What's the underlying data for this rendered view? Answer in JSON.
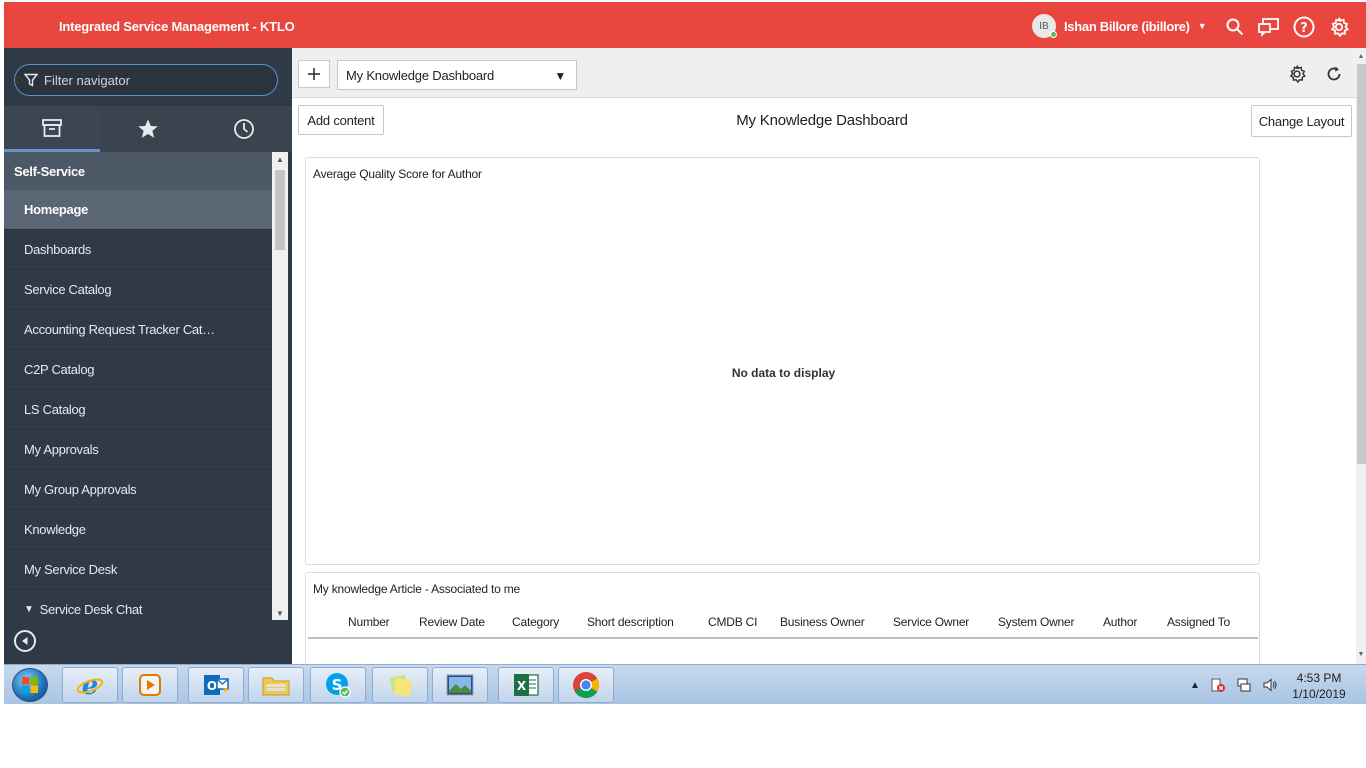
{
  "header": {
    "title": "Integrated Service Management - KTLO",
    "user_initials": "IB",
    "user_name": "Ishan Billore (ibillore)"
  },
  "sidebar": {
    "filter_placeholder": "Filter navigator",
    "section": "Self-Service",
    "items": [
      {
        "label": "Homepage"
      },
      {
        "label": "Dashboards"
      },
      {
        "label": "Service Catalog"
      },
      {
        "label": "Accounting Request Tracker Cat…"
      },
      {
        "label": "C2P Catalog"
      },
      {
        "label": "LS Catalog"
      },
      {
        "label": "My Approvals"
      },
      {
        "label": "My Group Approvals"
      },
      {
        "label": "Knowledge"
      },
      {
        "label": "My Service Desk"
      },
      {
        "label": "Service Desk Chat"
      }
    ]
  },
  "toolbar": {
    "dashboard_select": "My Knowledge Dashboard"
  },
  "dashboard": {
    "add_content_label": "Add content",
    "title": "My Knowledge Dashboard",
    "change_layout_label": "Change Layout",
    "widget1": {
      "title": "Average Quality Score for Author",
      "empty_message": "No data to display"
    },
    "widget2": {
      "title": "My knowledge Article - Associated to me",
      "columns": [
        "Number",
        "Review Date",
        "Category",
        "Short description",
        "CMDB CI",
        "Business Owner",
        "Service Owner",
        "System Owner",
        "Author",
        "Assigned To"
      ]
    }
  },
  "taskbar": {
    "time": "4:53 PM",
    "date": "1/10/2019"
  },
  "colors": {
    "header": "#e8463f",
    "sidebar": "#303a46",
    "accent": "#5b8ed6"
  }
}
